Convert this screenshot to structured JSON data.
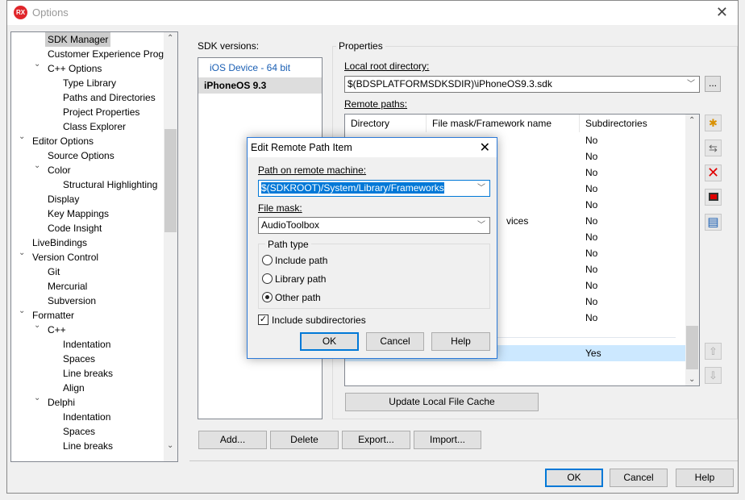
{
  "window": {
    "title": "Options",
    "logo": "RX"
  },
  "tree": {
    "items": [
      {
        "label": "SDK Manager",
        "level": 2,
        "selected": true
      },
      {
        "label": "Customer Experience Progr",
        "level": 2
      },
      {
        "label": "C++ Options",
        "level": 2,
        "expanded": true
      },
      {
        "label": "Type Library",
        "level": 3
      },
      {
        "label": "Paths and Directories",
        "level": 3
      },
      {
        "label": "Project Properties",
        "level": 3
      },
      {
        "label": "Class Explorer",
        "level": 3
      },
      {
        "label": "Editor Options",
        "level": 1,
        "expanded": true
      },
      {
        "label": "Source Options",
        "level": 2
      },
      {
        "label": "Color",
        "level": 2,
        "expanded": true
      },
      {
        "label": "Structural Highlighting",
        "level": 3
      },
      {
        "label": "Display",
        "level": 2
      },
      {
        "label": "Key Mappings",
        "level": 2
      },
      {
        "label": "Code Insight",
        "level": 2
      },
      {
        "label": "LiveBindings",
        "level": 1
      },
      {
        "label": "Version Control",
        "level": 1,
        "expanded": true
      },
      {
        "label": "Git",
        "level": 2
      },
      {
        "label": "Mercurial",
        "level": 2
      },
      {
        "label": "Subversion",
        "level": 2
      },
      {
        "label": "Formatter",
        "level": 1,
        "expanded": true
      },
      {
        "label": "C++",
        "level": 2,
        "expanded": true
      },
      {
        "label": "Indentation",
        "level": 3
      },
      {
        "label": "Spaces",
        "level": 3
      },
      {
        "label": "Line breaks",
        "level": 3
      },
      {
        "label": "Align",
        "level": 3
      },
      {
        "label": "Delphi",
        "level": 2,
        "expanded": true
      },
      {
        "label": "Indentation",
        "level": 3
      },
      {
        "label": "Spaces",
        "level": 3
      },
      {
        "label": "Line breaks",
        "level": 3
      }
    ]
  },
  "sdk": {
    "label": "SDK versions:",
    "items": [
      {
        "label": "iOS Device - 64 bit",
        "selected": false
      },
      {
        "label": "iPhoneOS 9.3",
        "selected": true
      }
    ],
    "buttons": {
      "add": "Add...",
      "delete": "Delete",
      "export": "Export...",
      "import": "Import..."
    }
  },
  "properties": {
    "label": "Properties",
    "local_root_label": "Local root directory:",
    "local_root_value": "$(BDSPLATFORMSDKSDIR)\\iPhoneOS9.3.sdk",
    "browse": "...",
    "remote_label": "Remote paths:",
    "columns": [
      "Directory",
      "File mask/Framework name",
      "Subdirectories"
    ],
    "rows": [
      "No",
      "No",
      "No",
      "No",
      "No",
      "No",
      "No",
      "No",
      "No",
      "No",
      "No",
      "No"
    ],
    "partial_mask": "vices",
    "selected_row_sub": "Yes",
    "update_button": "Update Local File Cache",
    "side_icons": [
      "add-folder-icon",
      "replace-icon",
      "delete-icon",
      "record-icon",
      "save-icon",
      "move-up-icon",
      "move-down-icon"
    ]
  },
  "footer": {
    "ok": "OK",
    "cancel": "Cancel",
    "help": "Help"
  },
  "dialog": {
    "title": "Edit Remote Path Item",
    "path_label": "Path on remote machine:",
    "path_value": "$(SDKROOT)/System/Library/Frameworks",
    "mask_label": "File mask:",
    "mask_value": "AudioToolbox",
    "path_type_label": "Path type",
    "radios": [
      {
        "label": "Include path",
        "checked": false
      },
      {
        "label": "Library path",
        "checked": false
      },
      {
        "label": "Other path",
        "checked": true
      }
    ],
    "include_sub_label": "Include subdirectories",
    "include_sub_checked": true,
    "ok": "OK",
    "cancel": "Cancel",
    "help": "Help"
  },
  "colors": {
    "accent": "#0078d7",
    "selection": "#cce8ff",
    "logo": "#e0262b"
  }
}
